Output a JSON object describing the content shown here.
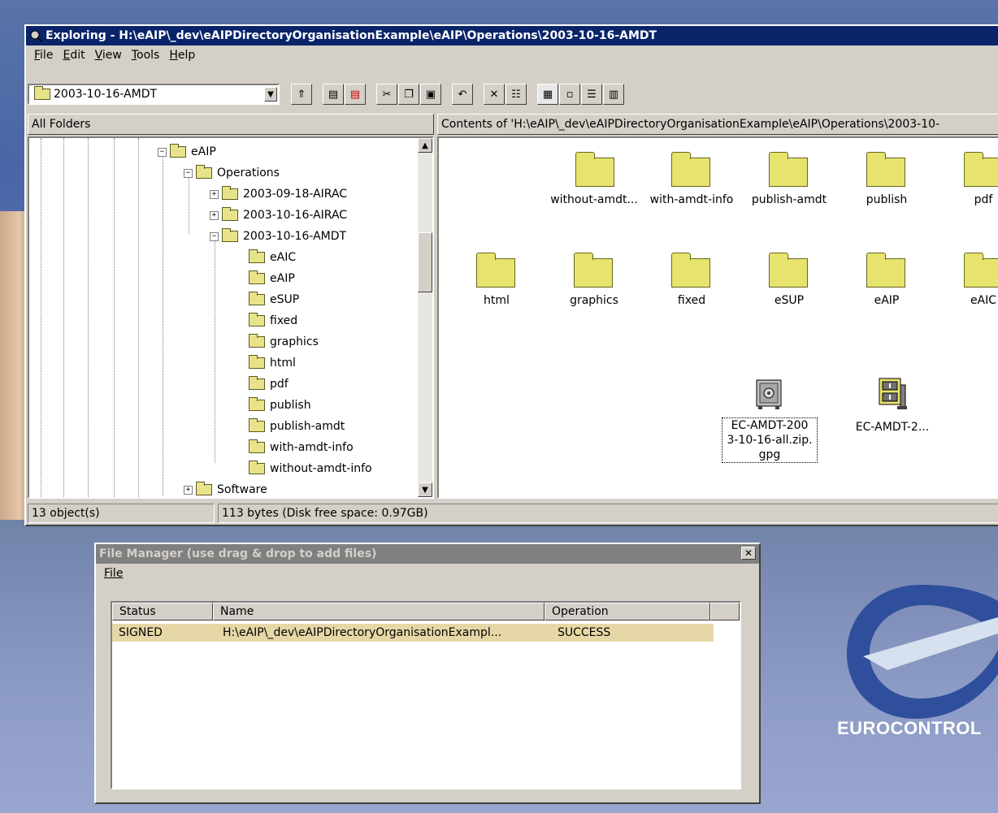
{
  "explorer": {
    "title": "Exploring - H:\\eAIP\\_dev\\eAIPDirectoryOrganisationExample\\eAIP\\Operations\\2003-10-16-AMDT",
    "menu": [
      {
        "label": "File",
        "key": "F"
      },
      {
        "label": "Edit",
        "key": "E"
      },
      {
        "label": "View",
        "key": "V"
      },
      {
        "label": "Tools",
        "key": "T"
      },
      {
        "label": "Help",
        "key": "H"
      }
    ],
    "address": "2003-10-16-AMDT",
    "all_folders_label": "All Folders",
    "contents_label": "Contents of 'H:\\eAIP\\_dev\\eAIPDirectoryOrganisationExample\\eAIP\\Operations\\2003-10-",
    "tree": [
      {
        "label": "eAIP"
      },
      {
        "label": "Operations"
      },
      {
        "label": "2003-09-18-AIRAC"
      },
      {
        "label": "2003-10-16-AIRAC"
      },
      {
        "label": "2003-10-16-AMDT"
      },
      {
        "label": "eAIC"
      },
      {
        "label": "eAIP"
      },
      {
        "label": "eSUP"
      },
      {
        "label": "fixed"
      },
      {
        "label": "graphics"
      },
      {
        "label": "html"
      },
      {
        "label": "pdf"
      },
      {
        "label": "publish"
      },
      {
        "label": "publish-amdt"
      },
      {
        "label": "with-amdt-info"
      },
      {
        "label": "without-amdt-info"
      },
      {
        "label": "Software"
      }
    ],
    "icons": [
      {
        "label": "without-amdt..."
      },
      {
        "label": "with-amdt-info"
      },
      {
        "label": "publish-amdt"
      },
      {
        "label": "publish"
      },
      {
        "label": "pdf"
      },
      {
        "label": "html"
      },
      {
        "label": "graphics"
      },
      {
        "label": "fixed"
      },
      {
        "label": "eSUP"
      },
      {
        "label": "eAIP"
      },
      {
        "label": "eAIC"
      }
    ],
    "file_icons": [
      {
        "label_lines": [
          "EC-AMDT-200",
          "3-10-16-all.zip.",
          "gpg"
        ],
        "icon": "safe-icon"
      },
      {
        "label": "EC-AMDT-2...",
        "icon": "zip-archive-icon"
      }
    ],
    "status": {
      "objects": "13 object(s)",
      "size": "113 bytes (Disk free space: 0.97GB)"
    }
  },
  "file_manager": {
    "title": "File Manager (use drag & drop to add files)",
    "menu_file": "File",
    "columns": [
      "Status",
      "Name",
      "Operation"
    ],
    "rows": [
      {
        "status": "SIGNED",
        "name": "H:\\eAIP\\_dev\\eAIPDirectoryOrganisationExampl...",
        "operation": "SUCCESS"
      }
    ]
  },
  "desktop": {
    "brand": "EUROCONTROL"
  }
}
